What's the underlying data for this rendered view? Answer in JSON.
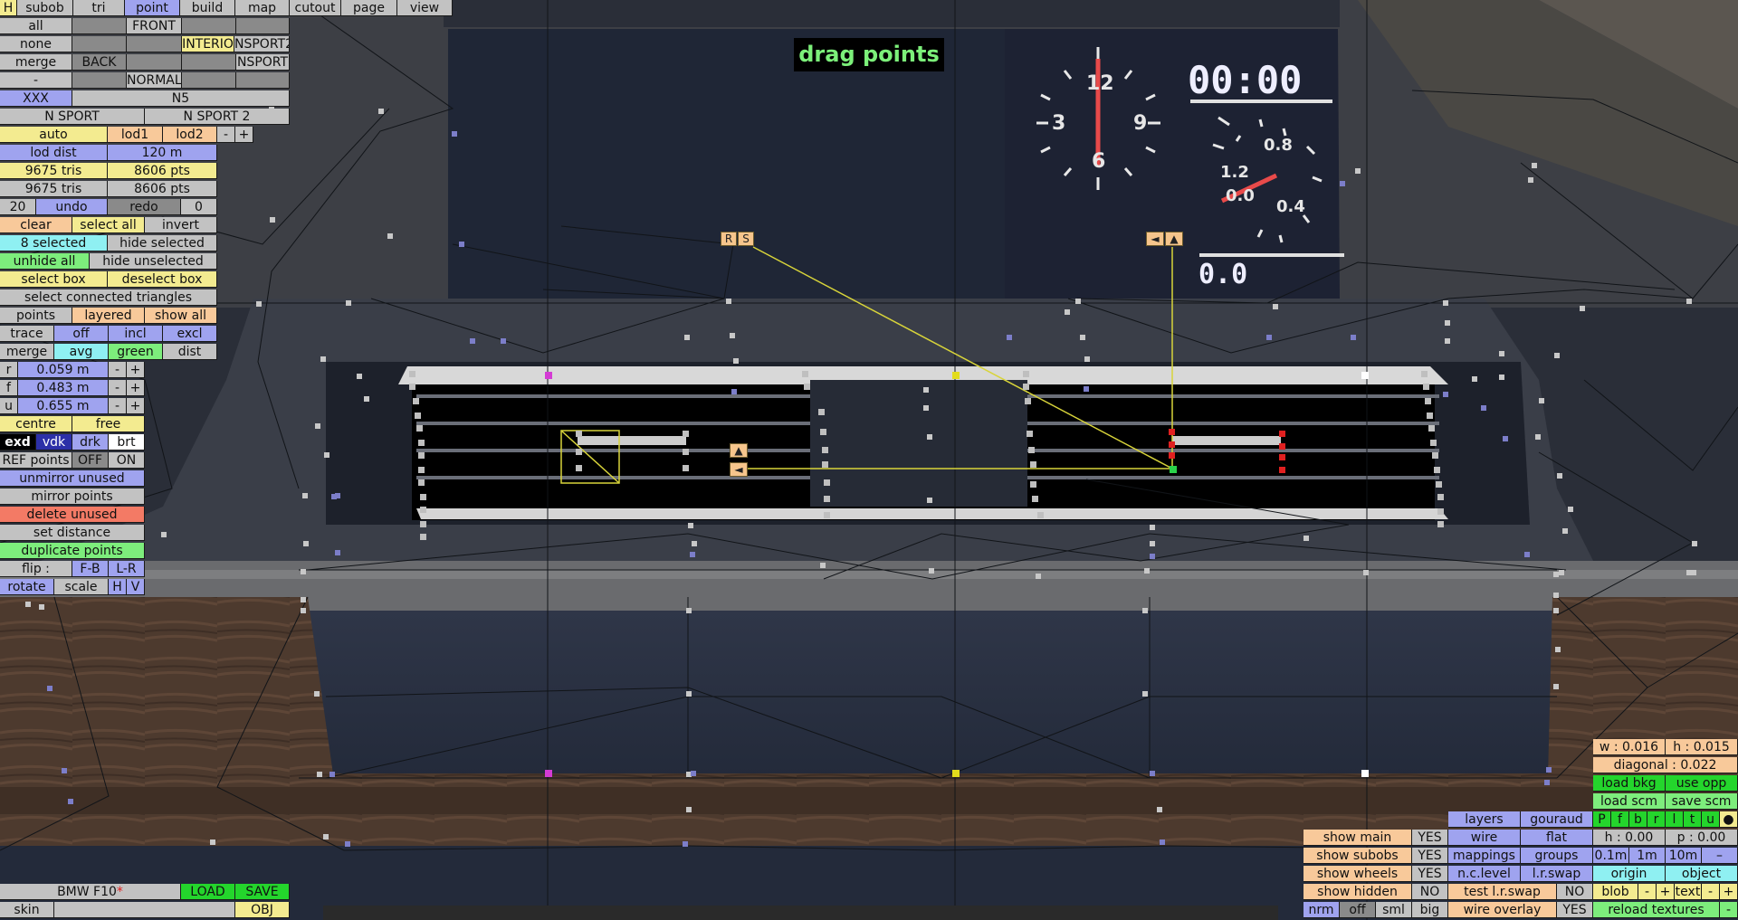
{
  "title_badge": "drag points",
  "clock_readout": "00:00",
  "speed_readout": "0.0",
  "gauge_left_labels": [
    "12",
    "3",
    "9",
    "6"
  ],
  "gauge_right_labels": [
    "1.2",
    "0.8",
    "0.0",
    "0.4"
  ],
  "markers": {
    "r_label": "R",
    "s_label": "S",
    "arrow_left": "◄",
    "arrow_up": "▲"
  },
  "top_menu": {
    "h": "H",
    "subob": "subob",
    "tri": "tri",
    "point": "point",
    "build": "build",
    "map": "map",
    "cutout": "cutout",
    "page": "page",
    "view": "view"
  },
  "left": {
    "all": "all",
    "front": "FRONT",
    "none": "none",
    "interio": "INTERIO",
    "nsport2": "NSPORT2",
    "merge_top": "merge",
    "back": "BACK",
    "nsport": "NSPORT",
    "dash": "-",
    "normal": "NORMAL",
    "xxx": "XXX",
    "n5": "N5",
    "n_sport": "N SPORT",
    "n_sport_2": "N SPORT 2",
    "auto": "auto",
    "lod1": "lod1",
    "lod2": "lod2",
    "minus": "-",
    "plus": "+",
    "lod_dist": "lod dist",
    "lod_dist_value": "120 m",
    "tris1": "9675 tris",
    "pts1": "8606 pts",
    "tris2": "9675 tris",
    "pts2": "8606 pts",
    "undo_count": "20",
    "undo": "undo",
    "redo": "redo",
    "redo_count": "0",
    "clear": "clear",
    "select_all": "select all",
    "invert": "invert",
    "selected": "8 selected",
    "hide_selected": "hide selected",
    "unhide_all": "unhide all",
    "hide_unselected": "hide unselected",
    "select_box": "select box",
    "deselect_box": "deselect box",
    "select_connected": "select connected triangles",
    "points": "points",
    "layered": "layered",
    "show_all": "show all",
    "trace": "trace",
    "off": "off",
    "incl": "incl",
    "excl": "excl",
    "merge": "merge",
    "avg": "avg",
    "green": "green",
    "dist": "dist",
    "r": "r",
    "r_val": "0.059 m",
    "f": "f",
    "f_val": "0.483 m",
    "u": "u",
    "u_val": "0.655 m",
    "centre": "centre",
    "free": "free",
    "exd": "exd",
    "vdk": "vdk",
    "drk": "drk",
    "brt": "brt",
    "ref_points": "REF points",
    "ref_off": "OFF",
    "ref_on": "ON",
    "unmirror_unused": "unmirror unused",
    "mirror_points": "mirror points",
    "delete_unused": "delete unused",
    "set_distance": "set distance",
    "duplicate_points": "duplicate points",
    "flip": "flip :",
    "fb": "F-B",
    "lr": "L-R",
    "rotate": "rotate",
    "scale": "scale",
    "h": "H",
    "v": "V"
  },
  "file_bar": {
    "car_name": "BMW F10",
    "unsaved_mark": "*",
    "load": "LOAD",
    "save": "SAVE",
    "skin": "skin",
    "obj": "OBJ"
  },
  "right": {
    "w": "w : 0.016",
    "h": "h : 0.015",
    "diagonal": "diagonal : 0.022",
    "load_bkg": "load bkg",
    "use_opp": "use opp",
    "load_scm": "load scm",
    "save_scm": "save scm",
    "layers": "layers",
    "gouraud": "gouraud",
    "pfbrltu": [
      "P",
      "f",
      "b",
      "r",
      "l",
      "t",
      "u",
      "●"
    ],
    "wire": "wire",
    "flat": "flat",
    "h0": "h : 0.00",
    "p0": "p : 0.00",
    "mappings": "mappings",
    "groups": "groups",
    "m01": "0.1m",
    "m1": "1m",
    "m10": "10m",
    "mdash": "–",
    "nclevel": "n.c.level",
    "lrswap": "l.r.swap",
    "origin": "origin",
    "object": "object",
    "test_lrswap": "test l.r.swap",
    "no": "NO",
    "blob": "blob",
    "text": "text",
    "wire_overlay": "wire overlay",
    "yes": "YES",
    "reload_textures": "reload textures",
    "show_main": "show main",
    "show_subobs": "show subobs",
    "show_wheels": "show wheels",
    "show_hidden": "show hidden",
    "nrm": "nrm",
    "off": "off",
    "sml": "sml",
    "big": "big"
  }
}
